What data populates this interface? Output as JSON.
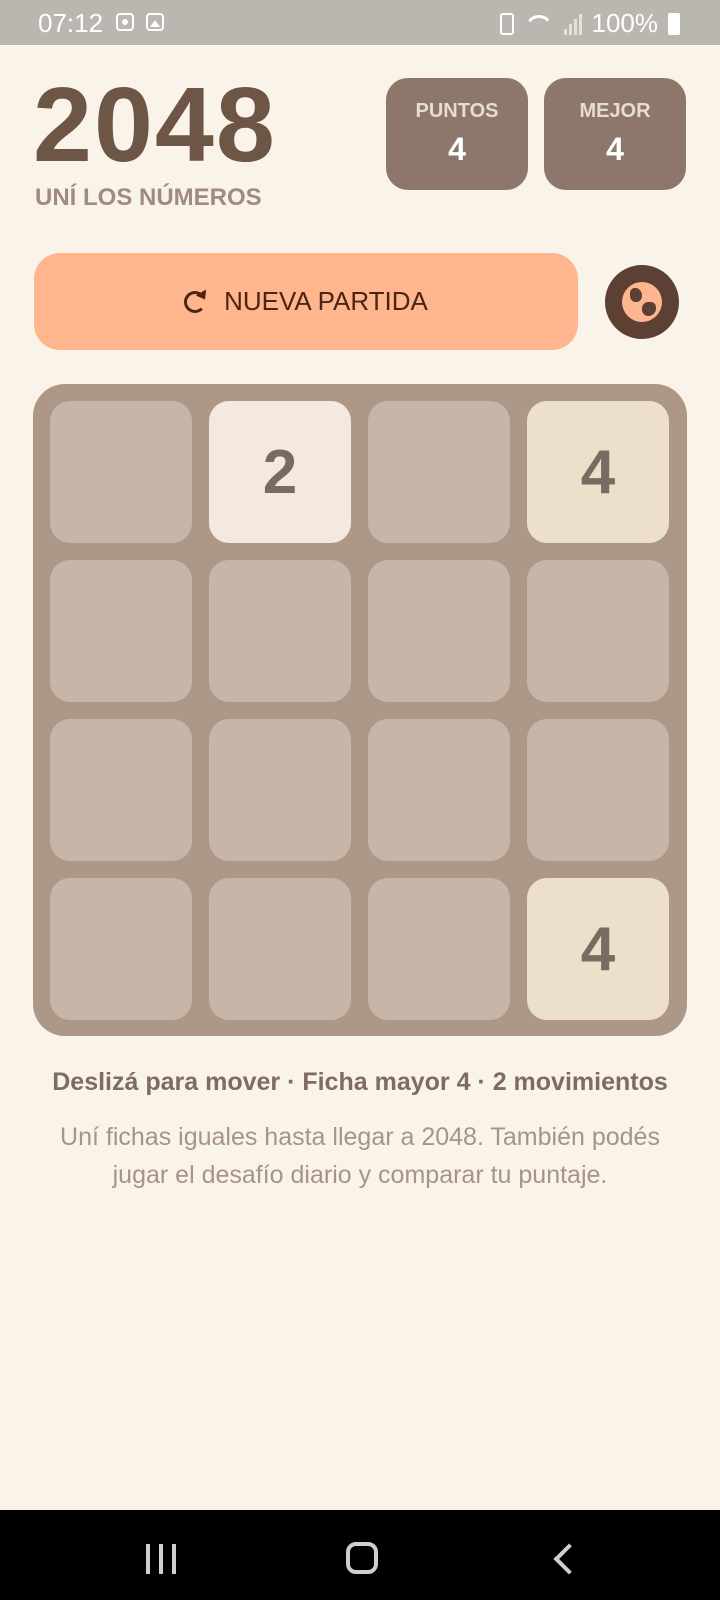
{
  "status_bar": {
    "time": "07:12",
    "left_icons": [
      "notification-icon",
      "image-icon"
    ],
    "right_icons": [
      "battery-saver-icon",
      "wifi-icon",
      "signal-icon",
      "battery-icon"
    ],
    "battery": "100%"
  },
  "header": {
    "title": "2048",
    "subtitle": "UNÍ LOS NÚMEROS"
  },
  "scores": [
    {
      "label": "PUNTOS",
      "value": "4"
    },
    {
      "label": "MEJOR",
      "value": "4"
    }
  ],
  "actions": {
    "new_game_label": "NUEVA PARTIDA",
    "new_game_icon": "refresh-icon",
    "globe_icon": "globe-icon"
  },
  "board": {
    "grid": [
      [
        "",
        "2",
        "",
        "4"
      ],
      [
        "",
        "",
        "",
        ""
      ],
      [
        "",
        "",
        "",
        ""
      ],
      [
        "",
        "",
        "",
        "4"
      ]
    ]
  },
  "footer": {
    "summary": "Deslizá para mover · Ficha mayor 4 · 2 movimientos",
    "help": "Uní fichas iguales hasta llegar a 2048. También podés jugar el desafío diario y comparar tu puntaje."
  },
  "nav_bar": {
    "icons": [
      "recents-icon",
      "home-icon",
      "back-icon"
    ]
  },
  "colors": {
    "background": "#faf3e9",
    "title": "#6e5647",
    "score_box": "#8d776a",
    "new_game_button": "#ffb58d",
    "globe_button": "#5c4033",
    "board": "#ad9888",
    "empty_tile": "#c6b5a9",
    "tile_2": "#f3e9de",
    "tile_4": "#ece0ca"
  }
}
